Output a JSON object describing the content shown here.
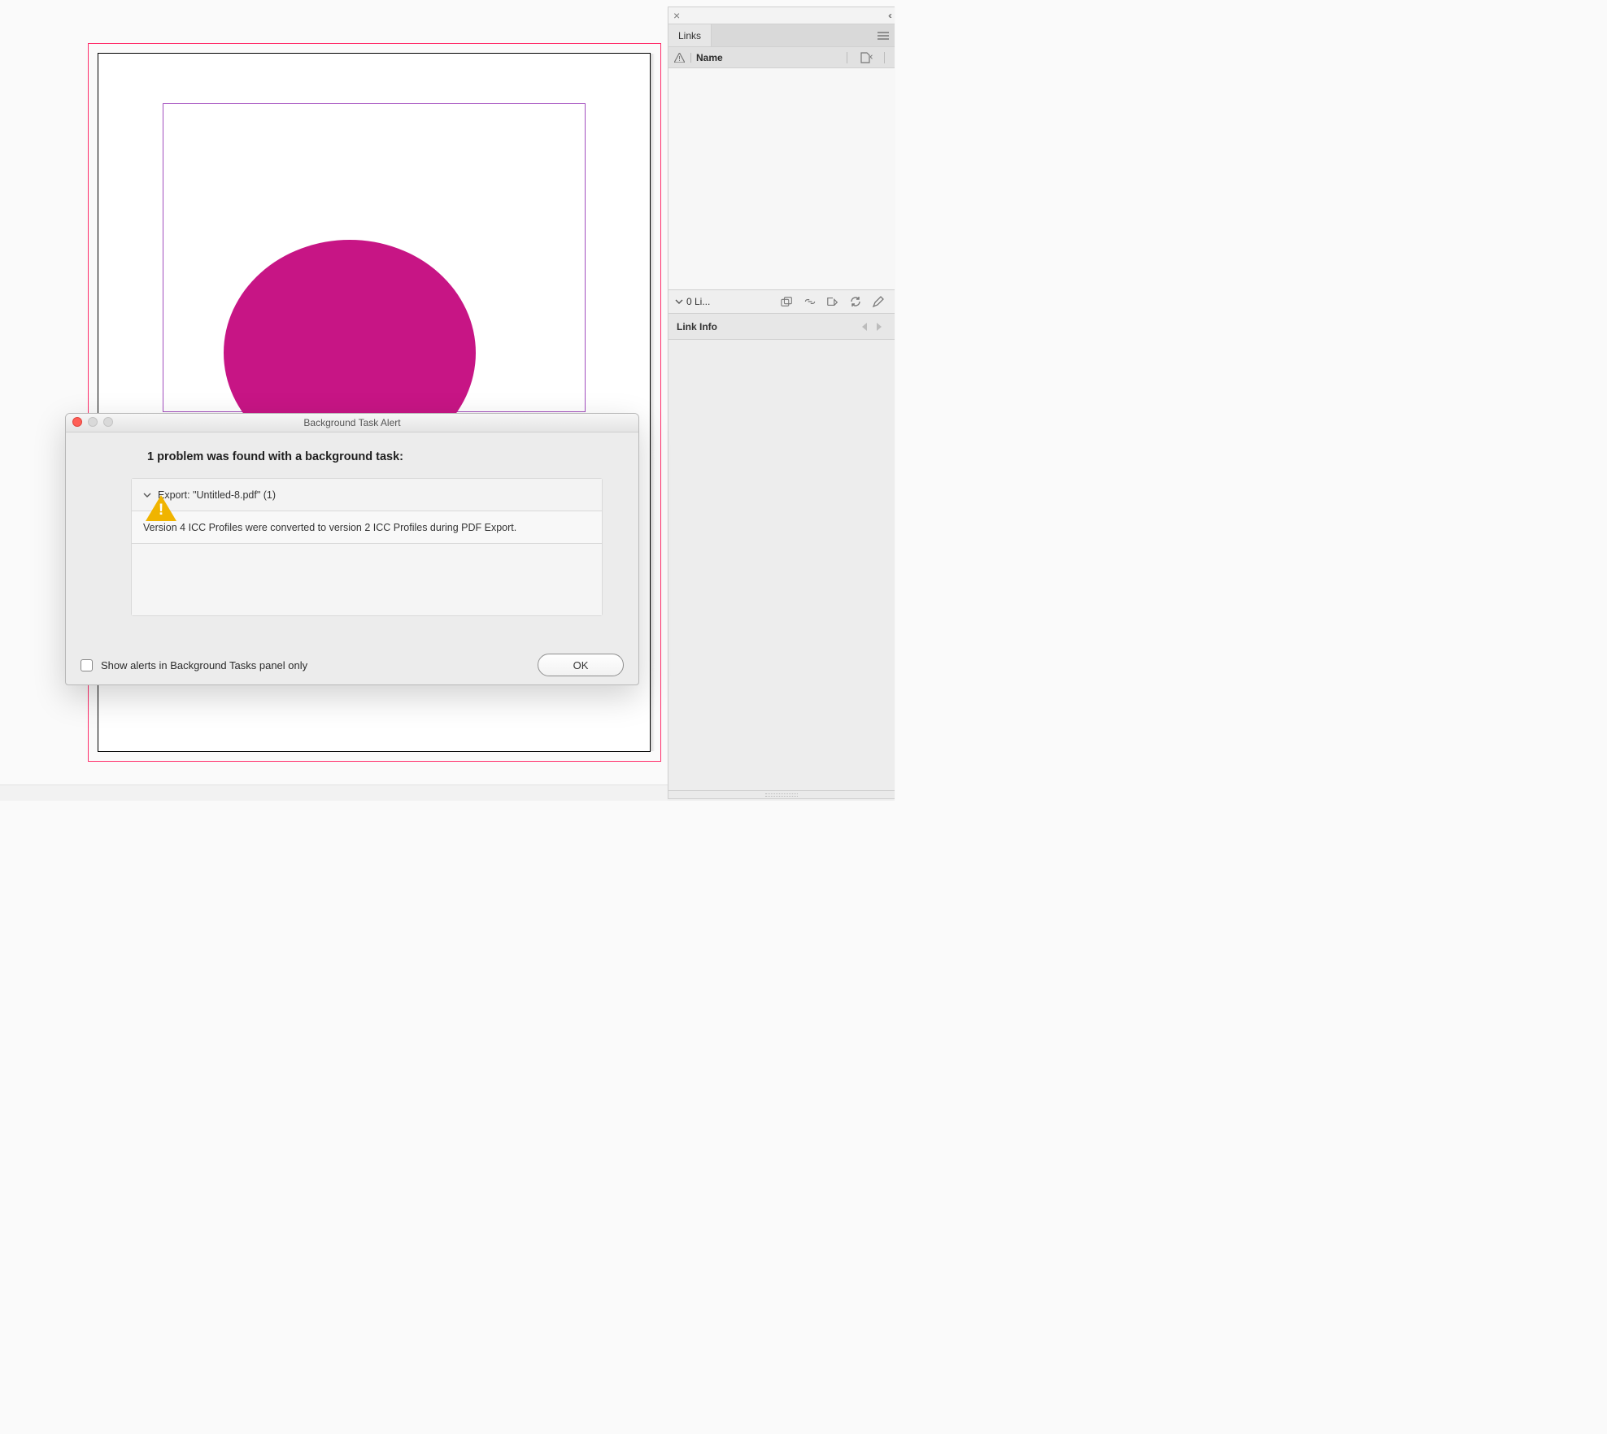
{
  "canvas": {
    "shape_fill": "#c71585"
  },
  "panel": {
    "tab_label": "Links",
    "columns": {
      "name": "Name"
    },
    "link_count_label": "0 Li...",
    "link_info_label": "Link Info"
  },
  "dialog": {
    "title": "Background Task Alert",
    "headline": "1 problem was found with a background task:",
    "task_row": "Export: \"Untitled-8.pdf\" (1)",
    "message": "Version 4 ICC Profiles were converted to version 2 ICC Profiles during PDF Export.",
    "checkbox_label": "Show alerts in Background Tasks panel only",
    "ok_label": "OK"
  }
}
